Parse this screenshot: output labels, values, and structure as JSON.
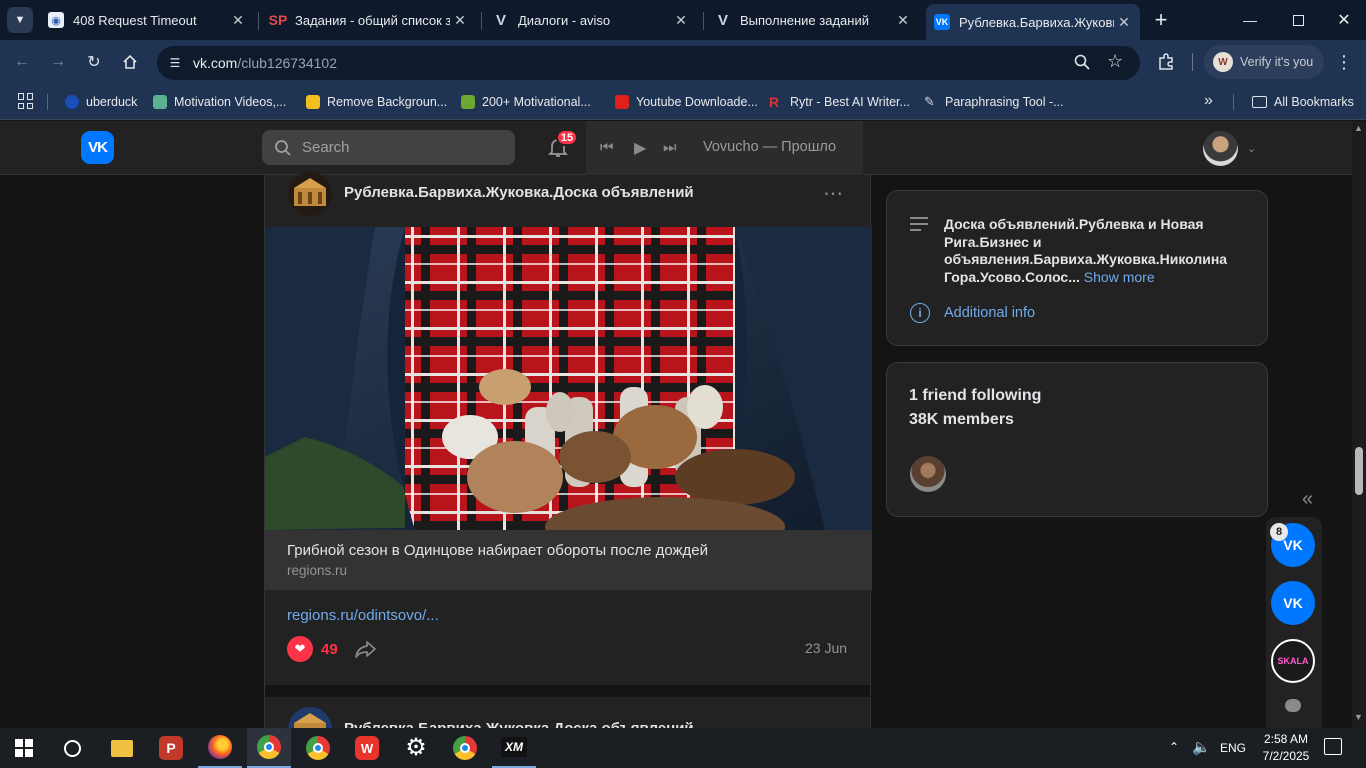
{
  "browser": {
    "tabs": [
      {
        "title": "408 Request Timeout",
        "icon": "globe-icon"
      },
      {
        "title": "Задания - общий список за",
        "icon": "sp-icon"
      },
      {
        "title": "Диалоги - aviso",
        "icon": "aviso-icon"
      },
      {
        "title": "Выполнение заданий",
        "icon": "aviso-icon"
      },
      {
        "title": "Рублевка.Барвиха.Жуковка.",
        "icon": "vk-icon"
      }
    ],
    "new_tab": "+",
    "url_host": "vk.com",
    "url_path": "/club126734102",
    "profile_label": "Verify it's you",
    "profile_initial": "W",
    "bookmarks": [
      {
        "label": "uberduck",
        "color": "#1a4fb8"
      },
      {
        "label": "Motivation Videos,...",
        "color": "#5bb08f"
      },
      {
        "label": "Remove Backgroun...",
        "color": "#f0c020"
      },
      {
        "label": "200+ Motivational...",
        "color": "#6aa832"
      },
      {
        "label": "Youtube Downloade...",
        "color": "#e0201a"
      },
      {
        "label": "Rytr - Best AI Writer...",
        "color": "#e03030"
      },
      {
        "label": "Paraphrasing Tool -...",
        "color": "#d8d8d8"
      }
    ],
    "all_bookmarks": "All Bookmarks"
  },
  "vk": {
    "logo": "VK",
    "search_placeholder": "Search",
    "notifications_count": "15",
    "player_track": "Vovucho — Прошло",
    "post": {
      "author": "Рублевка.Барвиха.Жуковка.Доска объявлений",
      "link_title": "Грибной сезон в Одинцове набирает обороты после дождей",
      "link_domain": "regions.ru",
      "link_url": "regions.ru/odintsovo/...",
      "likes": "49",
      "date": "23 Jun",
      "next_author": "Рублевка.Барвиха.Жуковка.Доска объявлений"
    },
    "about": {
      "description": "Доска объявлений.Рублевка и Новая Рига.Бизнес и объявления.Барвиха.Жуковка.Николина Гора.Усово.Солос...",
      "show_more": "Show more",
      "additional_info": "Additional info"
    },
    "members": {
      "friends_line": "1 friend following",
      "members_line": "38K members"
    },
    "chat_badge": "8",
    "chat_avatars": [
      "VK",
      "VK",
      "SKALA"
    ]
  },
  "taskbar": {
    "language": "ENG",
    "time": "2:58 AM",
    "date": "7/2/2025"
  },
  "colors": {
    "accent": "#0077ff",
    "link": "#71aaeb",
    "like": "#ff3347",
    "badge": "#ff3347"
  }
}
